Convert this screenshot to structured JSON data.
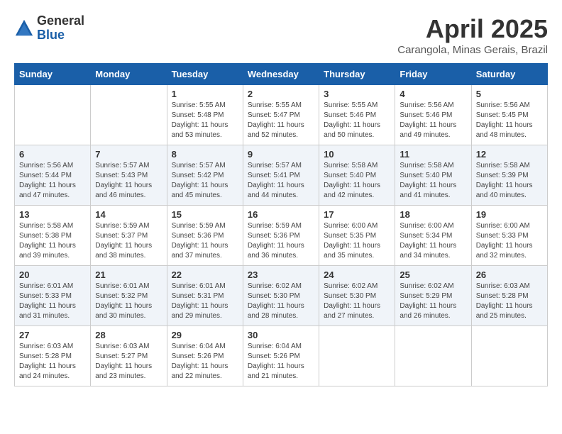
{
  "header": {
    "logo_general": "General",
    "logo_blue": "Blue",
    "title": "April 2025",
    "location": "Carangola, Minas Gerais, Brazil"
  },
  "days_of_week": [
    "Sunday",
    "Monday",
    "Tuesday",
    "Wednesday",
    "Thursday",
    "Friday",
    "Saturday"
  ],
  "weeks": [
    [
      {
        "day": "",
        "detail": ""
      },
      {
        "day": "",
        "detail": ""
      },
      {
        "day": "1",
        "detail": "Sunrise: 5:55 AM\nSunset: 5:48 PM\nDaylight: 11 hours and 53 minutes."
      },
      {
        "day": "2",
        "detail": "Sunrise: 5:55 AM\nSunset: 5:47 PM\nDaylight: 11 hours and 52 minutes."
      },
      {
        "day": "3",
        "detail": "Sunrise: 5:55 AM\nSunset: 5:46 PM\nDaylight: 11 hours and 50 minutes."
      },
      {
        "day": "4",
        "detail": "Sunrise: 5:56 AM\nSunset: 5:46 PM\nDaylight: 11 hours and 49 minutes."
      },
      {
        "day": "5",
        "detail": "Sunrise: 5:56 AM\nSunset: 5:45 PM\nDaylight: 11 hours and 48 minutes."
      }
    ],
    [
      {
        "day": "6",
        "detail": "Sunrise: 5:56 AM\nSunset: 5:44 PM\nDaylight: 11 hours and 47 minutes."
      },
      {
        "day": "7",
        "detail": "Sunrise: 5:57 AM\nSunset: 5:43 PM\nDaylight: 11 hours and 46 minutes."
      },
      {
        "day": "8",
        "detail": "Sunrise: 5:57 AM\nSunset: 5:42 PM\nDaylight: 11 hours and 45 minutes."
      },
      {
        "day": "9",
        "detail": "Sunrise: 5:57 AM\nSunset: 5:41 PM\nDaylight: 11 hours and 44 minutes."
      },
      {
        "day": "10",
        "detail": "Sunrise: 5:58 AM\nSunset: 5:40 PM\nDaylight: 11 hours and 42 minutes."
      },
      {
        "day": "11",
        "detail": "Sunrise: 5:58 AM\nSunset: 5:40 PM\nDaylight: 11 hours and 41 minutes."
      },
      {
        "day": "12",
        "detail": "Sunrise: 5:58 AM\nSunset: 5:39 PM\nDaylight: 11 hours and 40 minutes."
      }
    ],
    [
      {
        "day": "13",
        "detail": "Sunrise: 5:58 AM\nSunset: 5:38 PM\nDaylight: 11 hours and 39 minutes."
      },
      {
        "day": "14",
        "detail": "Sunrise: 5:59 AM\nSunset: 5:37 PM\nDaylight: 11 hours and 38 minutes."
      },
      {
        "day": "15",
        "detail": "Sunrise: 5:59 AM\nSunset: 5:36 PM\nDaylight: 11 hours and 37 minutes."
      },
      {
        "day": "16",
        "detail": "Sunrise: 5:59 AM\nSunset: 5:36 PM\nDaylight: 11 hours and 36 minutes."
      },
      {
        "day": "17",
        "detail": "Sunrise: 6:00 AM\nSunset: 5:35 PM\nDaylight: 11 hours and 35 minutes."
      },
      {
        "day": "18",
        "detail": "Sunrise: 6:00 AM\nSunset: 5:34 PM\nDaylight: 11 hours and 34 minutes."
      },
      {
        "day": "19",
        "detail": "Sunrise: 6:00 AM\nSunset: 5:33 PM\nDaylight: 11 hours and 32 minutes."
      }
    ],
    [
      {
        "day": "20",
        "detail": "Sunrise: 6:01 AM\nSunset: 5:33 PM\nDaylight: 11 hours and 31 minutes."
      },
      {
        "day": "21",
        "detail": "Sunrise: 6:01 AM\nSunset: 5:32 PM\nDaylight: 11 hours and 30 minutes."
      },
      {
        "day": "22",
        "detail": "Sunrise: 6:01 AM\nSunset: 5:31 PM\nDaylight: 11 hours and 29 minutes."
      },
      {
        "day": "23",
        "detail": "Sunrise: 6:02 AM\nSunset: 5:30 PM\nDaylight: 11 hours and 28 minutes."
      },
      {
        "day": "24",
        "detail": "Sunrise: 6:02 AM\nSunset: 5:30 PM\nDaylight: 11 hours and 27 minutes."
      },
      {
        "day": "25",
        "detail": "Sunrise: 6:02 AM\nSunset: 5:29 PM\nDaylight: 11 hours and 26 minutes."
      },
      {
        "day": "26",
        "detail": "Sunrise: 6:03 AM\nSunset: 5:28 PM\nDaylight: 11 hours and 25 minutes."
      }
    ],
    [
      {
        "day": "27",
        "detail": "Sunrise: 6:03 AM\nSunset: 5:28 PM\nDaylight: 11 hours and 24 minutes."
      },
      {
        "day": "28",
        "detail": "Sunrise: 6:03 AM\nSunset: 5:27 PM\nDaylight: 11 hours and 23 minutes."
      },
      {
        "day": "29",
        "detail": "Sunrise: 6:04 AM\nSunset: 5:26 PM\nDaylight: 11 hours and 22 minutes."
      },
      {
        "day": "30",
        "detail": "Sunrise: 6:04 AM\nSunset: 5:26 PM\nDaylight: 11 hours and 21 minutes."
      },
      {
        "day": "",
        "detail": ""
      },
      {
        "day": "",
        "detail": ""
      },
      {
        "day": "",
        "detail": ""
      }
    ]
  ]
}
